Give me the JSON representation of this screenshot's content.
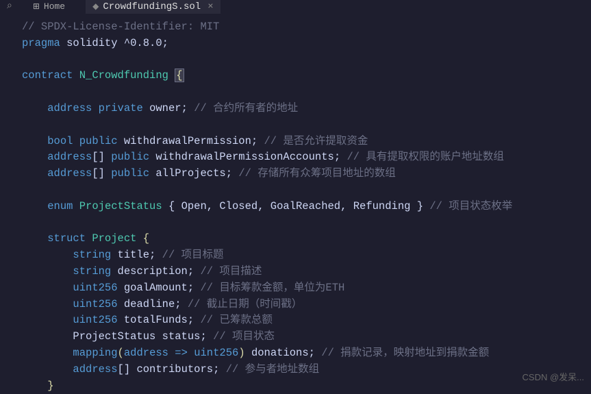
{
  "tabs": {
    "home_label": "Home",
    "active_file": "CrowdfundingS.sol"
  },
  "watermark": "CSDN @发呆...",
  "code": {
    "l1": "// SPDX-License-Identifier: MIT",
    "l2_pragma": "pragma",
    "l2_solidity": " solidity ",
    "l2_ver": "^0.8.0",
    "l2_semi": ";",
    "l4_contract": "contract",
    "l4_name": " N_Crowdfunding ",
    "l4_brace": "{",
    "l6_i": "    ",
    "l6_type": "address",
    "l6_priv": " private ",
    "l6_id": "owner",
    "l6_semi": "; ",
    "l6_c": "// 合约所有者的地址",
    "l8_type": "bool",
    "l8_pub": " public ",
    "l8_id": "withdrawalPermission",
    "l8_semi": "; ",
    "l8_c": "// 是否允许提取资金",
    "l9_type": "address",
    "l9_br": "[]",
    "l9_pub": " public ",
    "l9_id": "withdrawalPermissionAccounts",
    "l9_semi": "; ",
    "l9_c": "// 具有提取权限的账户地址数组",
    "l10_type": "address",
    "l10_br": "[]",
    "l10_pub": " public ",
    "l10_id": "allProjects",
    "l10_semi": "; ",
    "l10_c": "// 存储所有众筹项目地址的数组",
    "l12_enum": "enum",
    "l12_name": " ProjectStatus ",
    "l12_body": "{ Open, Closed, GoalReached, Refunding } ",
    "l12_c": "// 项目状态枚举",
    "l14_struct": "struct",
    "l14_name": " Project ",
    "l14_brace": "{",
    "l15_i": "        ",
    "l15_type": "string",
    "l15_id": " title",
    "l15_semi": "; ",
    "l15_c": "// 项目标题",
    "l16_type": "string",
    "l16_id": " description",
    "l16_semi": "; ",
    "l16_c": "// 项目描述",
    "l17_type": "uint256",
    "l17_id": " goalAmount",
    "l17_semi": "; ",
    "l17_c": "// 目标筹款金额，单位为ETH",
    "l18_type": "uint256",
    "l18_id": " deadline",
    "l18_semi": "; ",
    "l18_c": "// 截止日期（时间戳）",
    "l19_type": "uint256",
    "l19_id": " totalFunds",
    "l19_semi": "; ",
    "l19_c": "// 已筹款总额",
    "l20_type": "ProjectStatus",
    "l20_id": " status",
    "l20_semi": "; ",
    "l20_c": "// 项目状态",
    "l21_map": "mapping",
    "l21_p1": "(",
    "l21_addr": "address",
    "l21_arrow": " => ",
    "l21_uint": "uint256",
    "l21_p2": ")",
    "l21_id": " donations",
    "l21_semi": "; ",
    "l21_c": "// 捐款记录，映射地址到捐款金额",
    "l22_type": "address",
    "l22_br": "[]",
    "l22_id": " contributors",
    "l22_semi": "; ",
    "l22_c": "// 参与者地址数组",
    "l23_brace": "}"
  }
}
